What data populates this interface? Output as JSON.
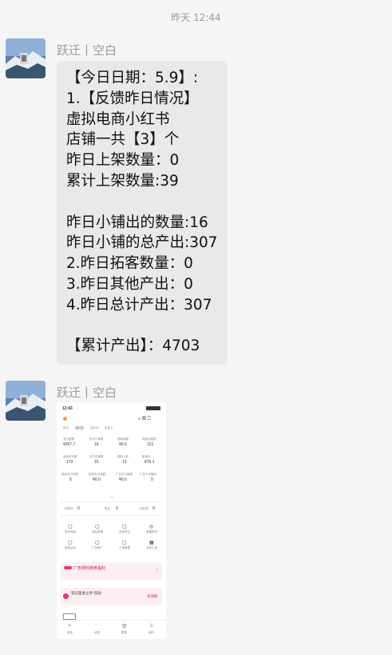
{
  "timestamp": "昨天 12:44",
  "messages": [
    {
      "sender": "跃迁丨空白",
      "lines": [
        "【今日日期：5.9】:",
        "1.【反馈昨日情况】",
        "虚拟电商小红书",
        "店铺一共【3】个",
        "昨日上架数量：0",
        "累计上架数量:39",
        "",
        "昨日小铺出的数量:16",
        "昨日小铺的总产出:307",
        "2.昨日拓客数量：0",
        "3.昨日其他产出：0",
        "4.昨日总计产出：307",
        "",
        "【累计产出】：4703"
      ]
    },
    {
      "sender": "跃迁丨空白",
      "image": {
        "status_time": "12:43",
        "tabs": [
          "昨日",
          "近7日",
          "近30日",
          "自定义"
        ],
        "stats": [
          {
            "label": "支付金额",
            "value": "¥307.7"
          },
          {
            "label": "支付订单数",
            "value": "16"
          },
          {
            "label": "退款金额",
            "value": "¥0.0"
          },
          {
            "label": "商品访客数",
            "value": "121"
          },
          {
            "label": "商品访问数",
            "value": "173"
          },
          {
            "label": "支付买家数",
            "value": "15"
          },
          {
            "label": "退款人数",
            "value": "12"
          },
          {
            "label": "客单价",
            "value": "¥76.1"
          },
          {
            "label": "商品支付件数",
            "value": "5"
          },
          {
            "label": "投放支付金额",
            "value": "¥0.0"
          },
          {
            "label": "广告支付金额",
            "value": "¥0.0"
          },
          {
            "label": "广告千次曝光",
            "value": "0"
          }
        ],
        "counts": [
          {
            "label": "待发货",
            "value": "0"
          },
          {
            "label": "售后",
            "value": "0"
          },
          {
            "label": "待处理",
            "value": "0"
          }
        ],
        "tools": [
          "发布商品",
          "商品管理",
          "发布笔记",
          "直播带货",
          "营销活动",
          "广告推广",
          "订单管理",
          "全部工具"
        ],
        "banner1": "广告限时赠券福利",
        "banner2": "笔记直发立享“双返”",
        "banner2_button": "去领取",
        "nav": [
          "首页",
          "消息",
          "数据",
          "我的"
        ]
      }
    }
  ]
}
